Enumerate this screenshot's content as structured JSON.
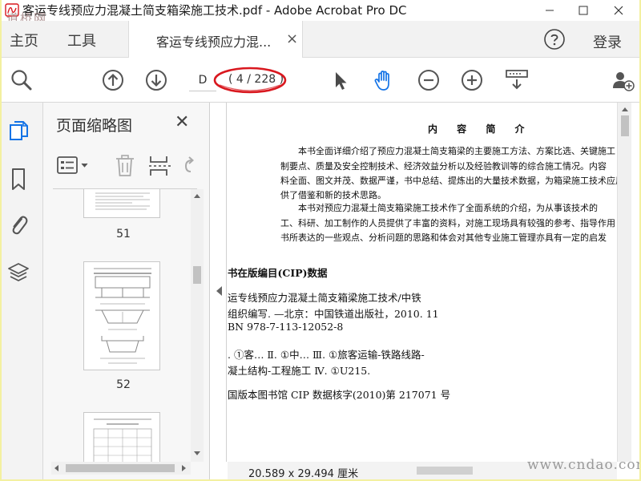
{
  "window": {
    "title": "客运专线预应力混凝土简支箱梁施工技术.pdf - Adobe Acrobat Pro DC",
    "watermark_top": "道桥网",
    "watermark_bottom": "www.cndao.com"
  },
  "tabs": {
    "home": "主页",
    "tools": "工具",
    "document_tab": "客运专线预应力混...",
    "sign_in": "登录"
  },
  "toolbar": {
    "page_input_value": "D",
    "page_count": "( 4 / 228 )"
  },
  "thumbnails": {
    "title": "页面缩略图",
    "pages": [
      {
        "number": "51"
      },
      {
        "number": "52"
      },
      {
        "number": ""
      }
    ]
  },
  "document": {
    "intro_heading": "内 容 简 介",
    "intro_lines": [
      "本书全面详细介绍了预应力混凝土简支箱梁的主要施工方法、方案比选、关键施工",
      "制要点、质量及安全控制技术、经济效益分析以及经验教训等的综合施工情况。内容",
      "料全面、图文并茂、数据严谨，书中总结、提炼出的大量技术数据，为箱梁施工技术应用",
      "供了借鉴和新的技术思路。",
      "本书对预应力混凝土简支箱梁施工技术作了全面系统的介绍，为从事该技术的",
      "工、科研、加工制作的人员提供了丰富的资料，对施工现场具有较强的参考、指导作用",
      "书所表达的一些观点、分析问题的思路和体会对其他专业施工管理亦具有一定的启发"
    ],
    "cip_heading": "书在版编目(CIP)数据",
    "cip_lines": [
      "运专线预应力混凝土简支箱梁施工技术/中铁",
      "组织编写. —北京：中国铁道出版社，2010. 11",
      "BN 978-7-113-12052-8",
      ". ①客…  Ⅱ. ①中…  Ⅲ. ①旅客运输-铁路线路-",
      "凝土结构-工程施工  Ⅳ. ①U215.",
      "国版本图书馆 CIP 数据核字(2010)第 217071 号"
    ],
    "page_size": "20.589 x 29.494 厘米"
  },
  "colors": {
    "accent_blue": "#1473e6",
    "annotation_red": "#d9181f",
    "icon_gray": "#555555"
  }
}
